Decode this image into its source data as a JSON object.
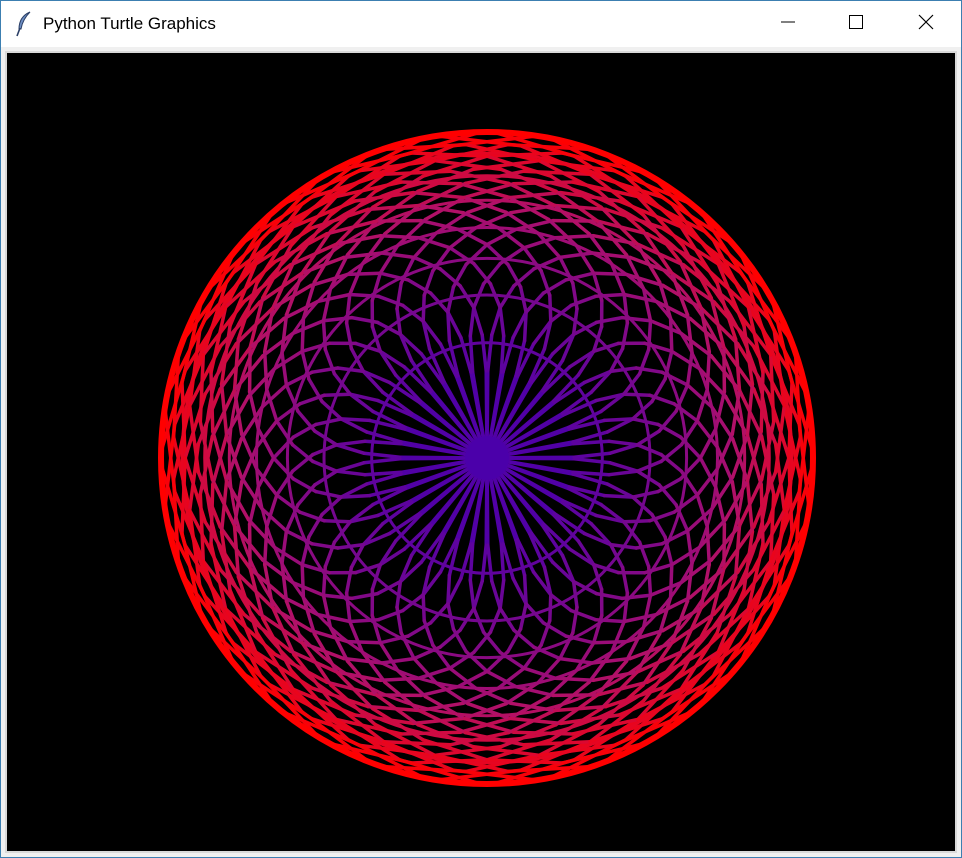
{
  "window": {
    "title": "Python Turtle Graphics",
    "icon": "feather-icon",
    "controls": [
      "minimize-icon",
      "maximize-icon",
      "close-icon"
    ]
  },
  "canvas": {
    "background": "#000000",
    "pattern": "circle-spiral",
    "colors": {
      "center": "#4b00aa",
      "middle": "#b0106a",
      "rim": "#ff0000"
    }
  }
}
